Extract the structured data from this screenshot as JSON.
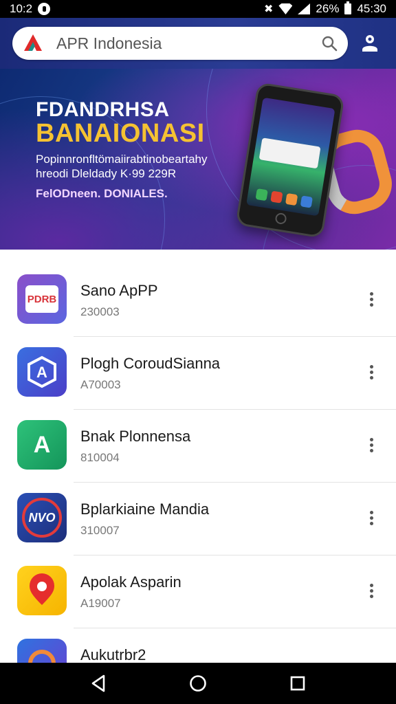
{
  "status_bar": {
    "time": "10:2",
    "battery": "26%",
    "clock_right": "45:30",
    "icons": [
      "alarm-icon",
      "mute-icon",
      "wifi-icon",
      "signal-icon",
      "battery-icon"
    ]
  },
  "search": {
    "text": "APR Indonesia",
    "icon": "search-icon",
    "action_icon": "account-icon"
  },
  "banner": {
    "title_line1": "FDANDRHSA",
    "title_line2": "BANAIONASI",
    "text_line1": "Popinnronfltömaiirabtinobeartahy",
    "text_line2": "hreodi Dleldady K·99 229R",
    "text_line3": "FelODneen. DONIALES.",
    "colors": {
      "title_accent": "#f5c232",
      "band": "#f0923a"
    }
  },
  "apps": [
    {
      "name": "Sano ApPP",
      "id": "230003",
      "icon": "house-app-icon",
      "icon_text": "PDRB"
    },
    {
      "name": "Plogh CoroudSianna",
      "id": "A70003",
      "icon": "shield-a-app-icon",
      "icon_text": "A"
    },
    {
      "name": "Bnak Plonnensa",
      "id": "810004",
      "icon": "green-a-app-icon",
      "icon_text": "A"
    },
    {
      "name": "Bplarkiaine Mandia",
      "id": "310007",
      "icon": "nvo-app-icon",
      "icon_text": "NVO"
    },
    {
      "name": "Apolak Asparin",
      "id": "A19007",
      "icon": "location-pin-app-icon",
      "icon_text": ""
    },
    {
      "name": "Aukutrbr2",
      "id": "",
      "icon": "circle-app-icon",
      "icon_text": ""
    }
  ],
  "nav": {
    "back": "back-icon",
    "home": "home-icon",
    "recents": "recents-icon"
  }
}
